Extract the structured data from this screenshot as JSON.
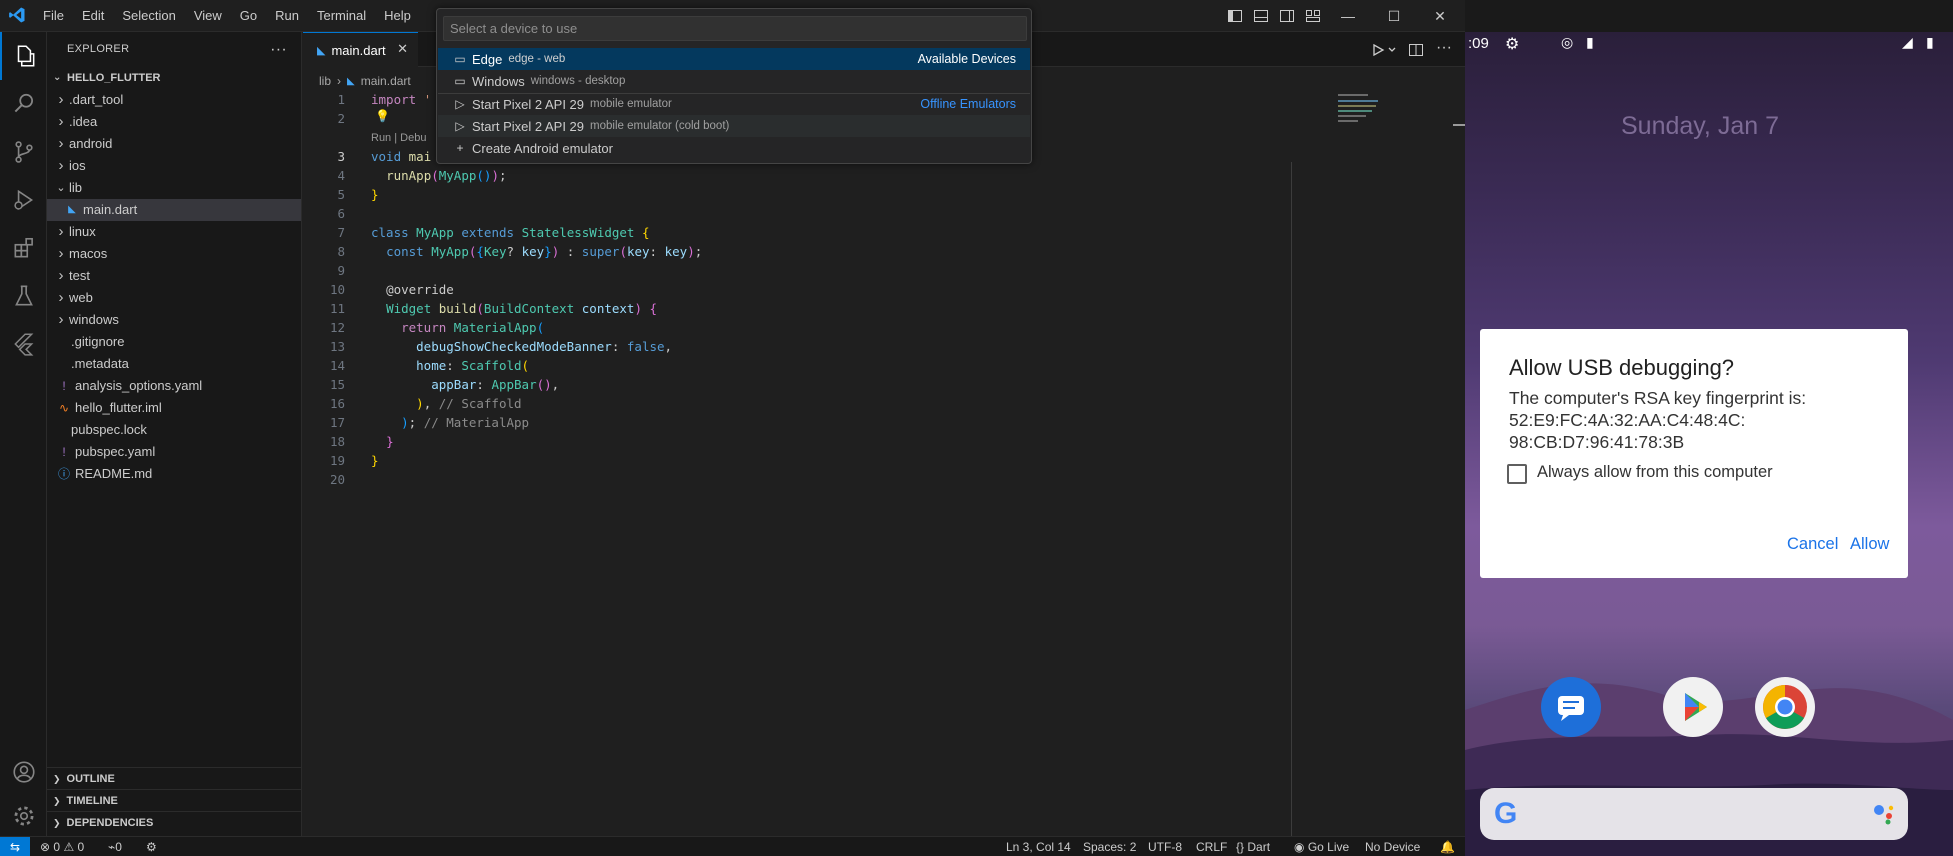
{
  "titlebar": {
    "menu": [
      "File",
      "Edit",
      "Selection",
      "View",
      "Go",
      "Run",
      "Terminal",
      "Help"
    ],
    "window_controls": {
      "minimize": "—",
      "maximize": "☐",
      "close": "✕"
    }
  },
  "sidebar": {
    "title": "EXPLORER",
    "root": "HELLO_FLUTTER",
    "items": [
      {
        "label": ".dart_tool",
        "type": "folder"
      },
      {
        "label": ".idea",
        "type": "folder"
      },
      {
        "label": "android",
        "type": "folder"
      },
      {
        "label": "ios",
        "type": "folder"
      },
      {
        "label": "lib",
        "type": "folder-open"
      },
      {
        "label": "main.dart",
        "type": "dart"
      },
      {
        "label": "linux",
        "type": "folder"
      },
      {
        "label": "macos",
        "type": "folder"
      },
      {
        "label": "test",
        "type": "folder"
      },
      {
        "label": "web",
        "type": "folder"
      },
      {
        "label": "windows",
        "type": "folder"
      },
      {
        "label": ".gitignore",
        "type": "file"
      },
      {
        "label": ".metadata",
        "type": "file"
      },
      {
        "label": "analysis_options.yaml",
        "type": "yaml"
      },
      {
        "label": "hello_flutter.iml",
        "type": "iml"
      },
      {
        "label": "pubspec.lock",
        "type": "file"
      },
      {
        "label": "pubspec.yaml",
        "type": "yaml"
      },
      {
        "label": "README.md",
        "type": "info"
      }
    ],
    "sections": [
      "OUTLINE",
      "TIMELINE",
      "DEPENDENCIES"
    ]
  },
  "editor": {
    "tab": "main.dart",
    "breadcrumb": [
      "lib",
      "main.dart"
    ],
    "code_lens": "Run | Debu",
    "line_numbers": [
      "1",
      "2",
      "3",
      "4",
      "5",
      "6",
      "7",
      "8",
      "9",
      "10",
      "11",
      "12",
      "13",
      "14",
      "15",
      "16",
      "17",
      "18",
      "19",
      "20"
    ]
  },
  "quickpick": {
    "placeholder": "Select a device to use",
    "items": [
      {
        "label": "Edge",
        "desc": "edge - web",
        "group": "Available Devices",
        "icon": "browser-icon"
      },
      {
        "label": "Windows",
        "desc": "windows - desktop",
        "group": "",
        "icon": "desktop-icon"
      },
      {
        "label": "Start Pixel 2 API 29",
        "desc": "mobile emulator",
        "group": "Offline Emulators",
        "icon": "play-icon"
      },
      {
        "label": "Start Pixel 2 API 29",
        "desc": "mobile emulator (cold boot)",
        "group": "",
        "icon": "play-icon"
      },
      {
        "label": "Create Android emulator",
        "desc": "",
        "group": "",
        "icon": "plus-icon"
      }
    ]
  },
  "statusbar": {
    "errors": "0",
    "warnings": "0",
    "ports": "0",
    "position": "Ln 3, Col 14",
    "spaces": "Spaces: 2",
    "encoding": "UTF-8",
    "eol": "CRLF",
    "language": "Dart",
    "golive": "Go Live",
    "device": "No Device"
  },
  "phone": {
    "time": ":09",
    "date": "Sunday, Jan 7",
    "dialog": {
      "title": "Allow USB debugging?",
      "body_line1": "The computer's RSA key fingerprint is:",
      "body_line2": "52:E9:FC:4A:32:AA:C4:48:4C:",
      "body_line3": "98:CB:D7:96:41:78:3B",
      "checkbox": "Always allow from this computer",
      "cancel": "Cancel",
      "allow": "Allow"
    }
  },
  "colors": {
    "accent": "#0078d4",
    "selection": "#04395e",
    "dialog_button": "#1a73e8"
  }
}
